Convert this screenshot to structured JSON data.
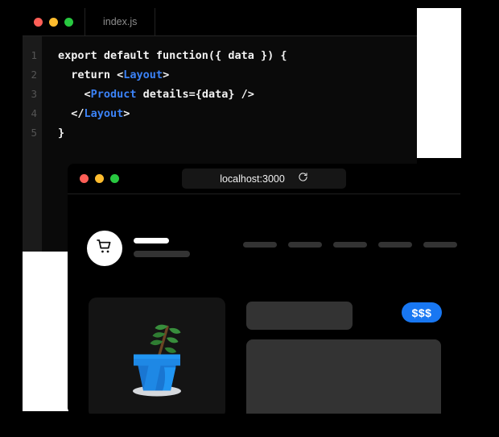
{
  "editor": {
    "window_controls": [
      {
        "name": "close",
        "color": "#ff5f57"
      },
      {
        "name": "minimize",
        "color": "#febc2e"
      },
      {
        "name": "maximize",
        "color": "#28c840"
      }
    ],
    "tab_label": "index.js",
    "gutter_numbers": [
      "1",
      "2",
      "3",
      "4",
      "5"
    ],
    "code_lines": [
      [
        {
          "text": "export default function({ data }) {",
          "color": "plain"
        }
      ],
      [
        {
          "text": "  return <",
          "color": "plain"
        },
        {
          "text": "Layout",
          "color": "blue"
        },
        {
          "text": ">",
          "color": "plain"
        }
      ],
      [
        {
          "text": "    <",
          "color": "plain"
        },
        {
          "text": "Product",
          "color": "blue"
        },
        {
          "text": " details={data} />",
          "color": "plain"
        }
      ],
      [
        {
          "text": "  </",
          "color": "plain"
        },
        {
          "text": "Layout",
          "color": "blue"
        },
        {
          "text": ">",
          "color": "plain"
        }
      ],
      [
        {
          "text": "}",
          "color": "plain"
        }
      ]
    ]
  },
  "browser": {
    "window_controls": [
      {
        "name": "close",
        "color": "#ff5f57"
      },
      {
        "name": "minimize",
        "color": "#febc2e"
      },
      {
        "name": "maximize",
        "color": "#28c840"
      }
    ],
    "url": "localhost:3000",
    "reload_icon": "reload-icon"
  },
  "site": {
    "cart_icon": "shopping-cart-icon",
    "brand_placeholder_lines": 2,
    "nav_links_count": 5,
    "product": {
      "image_icon": "potted-plant-illustration",
      "title_placeholder": "",
      "description_placeholder": "",
      "price_badge": "$$$"
    }
  },
  "colors": {
    "accent_blue": "#1877f2",
    "code_keyword_blue": "#3b82f6",
    "placeholder_gray": "#333333",
    "card_background": "#141414",
    "page_background": "#000000",
    "panel_white": "#ffffff"
  }
}
